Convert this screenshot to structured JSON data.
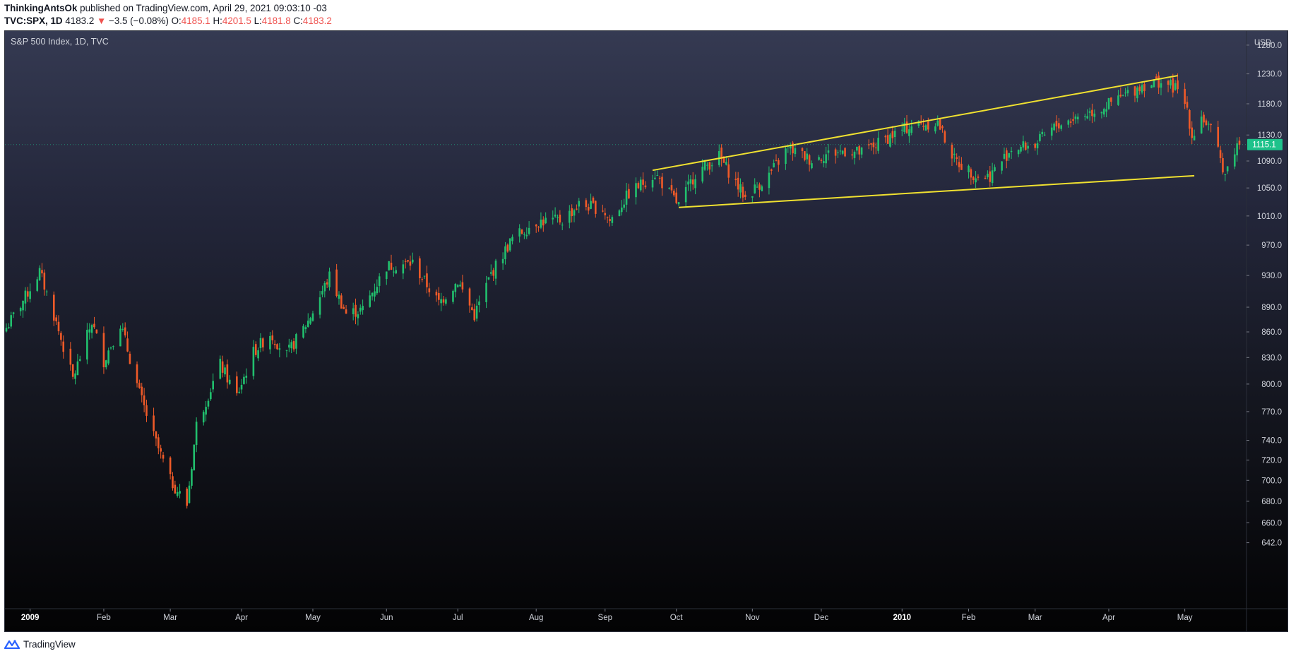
{
  "header": {
    "author": "ThinkingAntsOk",
    "published_text": " published on TradingView.com, April 29, 2021 09:03:10 -03",
    "symbol": "TVC:SPX, 1D",
    "last": "4183.2",
    "change": "−3.5 (−0.08%)",
    "o_label": "O:",
    "o_value": "4185.1",
    "h_label": "H:",
    "h_value": "4201.5",
    "l_label": "L:",
    "l_value": "4181.8",
    "c_label": "C:",
    "c_value": "4183.2"
  },
  "chart": {
    "symbol_label": "S&P 500 Index, 1D, TVC",
    "currency": "USD",
    "last_price_label": "1115.1"
  },
  "footer": {
    "brand": "TradingView"
  },
  "colors": {
    "up": "#26a69a",
    "up_bright": "#21c06e",
    "down": "#ef5350",
    "down_orange": "#f05a28",
    "trendline": "#f0e130",
    "price_tag": "#1ec28b"
  },
  "chart_data": {
    "type": "candlestick",
    "title": "S&P 500 Index, 1D, TVC",
    "ylabel": "USD",
    "y_scale": "log",
    "ylim": [
      625,
      1295
    ],
    "y_ticks": [
      1280,
      1230,
      1180,
      1130,
      1090,
      1050,
      1010,
      970,
      930,
      890,
      860,
      830,
      800,
      770,
      740,
      720,
      700,
      680,
      660,
      642
    ],
    "x_ticks": [
      {
        "label": "2009",
        "date": "2009-01-02"
      },
      {
        "label": "Feb",
        "date": "2009-02-02"
      },
      {
        "label": "Mar",
        "date": "2009-03-02"
      },
      {
        "label": "Apr",
        "date": "2009-04-01"
      },
      {
        "label": "May",
        "date": "2009-05-01"
      },
      {
        "label": "Jun",
        "date": "2009-06-01"
      },
      {
        "label": "Jul",
        "date": "2009-07-01"
      },
      {
        "label": "Aug",
        "date": "2009-08-03"
      },
      {
        "label": "Sep",
        "date": "2009-09-01"
      },
      {
        "label": "Oct",
        "date": "2009-10-01"
      },
      {
        "label": "Nov",
        "date": "2009-11-02"
      },
      {
        "label": "Dec",
        "date": "2009-12-01"
      },
      {
        "label": "2010",
        "date": "2010-01-04"
      },
      {
        "label": "Feb",
        "date": "2010-02-01"
      },
      {
        "label": "Mar",
        "date": "2010-03-01"
      },
      {
        "label": "Apr",
        "date": "2010-04-01"
      },
      {
        "label": "May",
        "date": "2010-05-03"
      }
    ],
    "x_range": [
      "2008-12-23",
      "2010-05-26"
    ],
    "close_points": [
      [
        "2008-12-23",
        865
      ],
      [
        "2008-12-31",
        903
      ],
      [
        "2009-01-06",
        935
      ],
      [
        "2009-01-12",
        880
      ],
      [
        "2009-01-20",
        806
      ],
      [
        "2009-01-28",
        872
      ],
      [
        "2009-02-02",
        826
      ],
      [
        "2009-02-09",
        870
      ],
      [
        "2009-02-17",
        790
      ],
      [
        "2009-02-23",
        744
      ],
      [
        "2009-03-02",
        700
      ],
      [
        "2009-03-09",
        677
      ],
      [
        "2009-03-13",
        756
      ],
      [
        "2009-03-23",
        822
      ],
      [
        "2009-03-30",
        787
      ],
      [
        "2009-04-06",
        836
      ],
      [
        "2009-04-13",
        858
      ],
      [
        "2009-04-20",
        833
      ],
      [
        "2009-04-29",
        873
      ],
      [
        "2009-05-08",
        929
      ],
      [
        "2009-05-15",
        882
      ],
      [
        "2009-05-22",
        887
      ],
      [
        "2009-06-01",
        942
      ],
      [
        "2009-06-12",
        946
      ],
      [
        "2009-06-18",
        918
      ],
      [
        "2009-06-23",
        895
      ],
      [
        "2009-07-01",
        923
      ],
      [
        "2009-07-08",
        880
      ],
      [
        "2009-07-15",
        932
      ],
      [
        "2009-07-24",
        979
      ],
      [
        "2009-08-03",
        1002
      ],
      [
        "2009-08-14",
        1004
      ],
      [
        "2009-08-21",
        1026
      ],
      [
        "2009-08-31",
        1020
      ],
      [
        "2009-09-03",
        1003
      ],
      [
        "2009-09-11",
        1042
      ],
      [
        "2009-09-22",
        1071
      ],
      [
        "2009-10-02",
        1025
      ],
      [
        "2009-10-09",
        1071
      ],
      [
        "2009-10-19",
        1097
      ],
      [
        "2009-10-30",
        1036
      ],
      [
        "2009-11-09",
        1069
      ],
      [
        "2009-11-17",
        1110
      ],
      [
        "2009-11-27",
        1091
      ],
      [
        "2009-12-03",
        1100
      ],
      [
        "2009-12-11",
        1106
      ],
      [
        "2009-12-18",
        1102
      ],
      [
        "2009-12-29",
        1126
      ],
      [
        "2010-01-08",
        1145
      ],
      [
        "2010-01-19",
        1150
      ],
      [
        "2010-01-26",
        1092
      ],
      [
        "2010-02-05",
        1066
      ],
      [
        "2010-02-10",
        1068
      ],
      [
        "2010-02-19",
        1109
      ],
      [
        "2010-03-01",
        1115
      ],
      [
        "2010-03-10",
        1145
      ],
      [
        "2010-03-19",
        1159
      ],
      [
        "2010-03-29",
        1173
      ],
      [
        "2010-04-05",
        1187
      ],
      [
        "2010-04-15",
        1211
      ],
      [
        "2010-04-23",
        1217
      ],
      [
        "2010-04-29",
        1206
      ],
      [
        "2010-05-04",
        1173
      ],
      [
        "2010-05-06",
        1128
      ],
      [
        "2010-05-10",
        1160
      ],
      [
        "2010-05-14",
        1136
      ],
      [
        "2010-05-20",
        1071
      ],
      [
        "2010-05-25",
        1115
      ]
    ],
    "trendlines": [
      {
        "from": [
          "2009-09-21",
          1076
        ],
        "to": [
          "2010-04-30",
          1227
        ]
      },
      {
        "from": [
          "2009-10-02",
          1022
        ],
        "to": [
          "2010-05-07",
          1068
        ]
      }
    ]
  }
}
